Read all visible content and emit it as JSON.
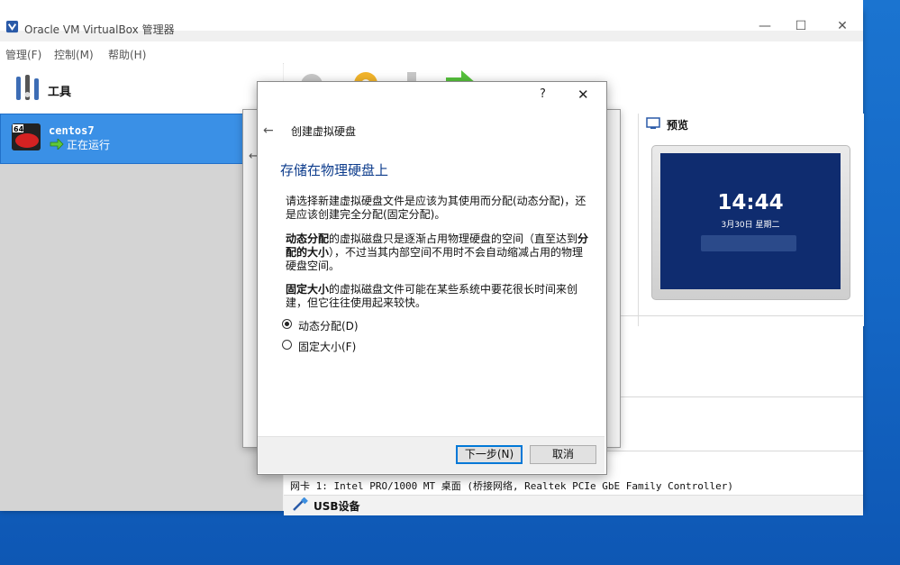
{
  "window": {
    "title": "Oracle VM VirtualBox 管理器",
    "minimize": "—",
    "maximize": "☐",
    "close": "✕"
  },
  "menu": [
    "管理(F)",
    "控制(M)",
    "帮助(H)"
  ],
  "sidebar": {
    "tools_label": "工具",
    "vm": {
      "name": "centos7",
      "status": "正在运行",
      "badge": "64"
    }
  },
  "preview": {
    "label": "预览",
    "time": "14:44",
    "date": "3月30日 星期二"
  },
  "details": {
    "network": "网卡 1:  Intel PRO/1000 MT 桌面 (桥接网络, Realtek PCIe GbE Family Controller)",
    "usb_label": "USB设备"
  },
  "dialog": {
    "help": "?",
    "close": "✕",
    "back": "←",
    "heading": "创建虚拟硬盘",
    "title": "存储在物理硬盘上",
    "para1": "请选择新建虚拟硬盘文件是应该为其使用而分配(动态分配)，还是应该创建完全分配(固定分配)。",
    "para2_bold": "动态分配",
    "para2_a": "的虚拟磁盘只是逐渐占用物理硬盘的空间（直至达到",
    "para2_bold2": "分配的大小",
    "para2_b": "），不过当其内部空间不用时不会自动缩减占用的物理硬盘空间。",
    "para3_bold": "固定大小",
    "para3_a": "的虚拟磁盘文件可能在某些系统中要花很长时间来创建，但它往往使用起来较快。",
    "options": [
      {
        "label": "动态分配(D)",
        "selected": true
      },
      {
        "label": "固定大小(F)",
        "selected": false
      }
    ],
    "next_button": "下一步(N)",
    "cancel_button": "取消"
  }
}
